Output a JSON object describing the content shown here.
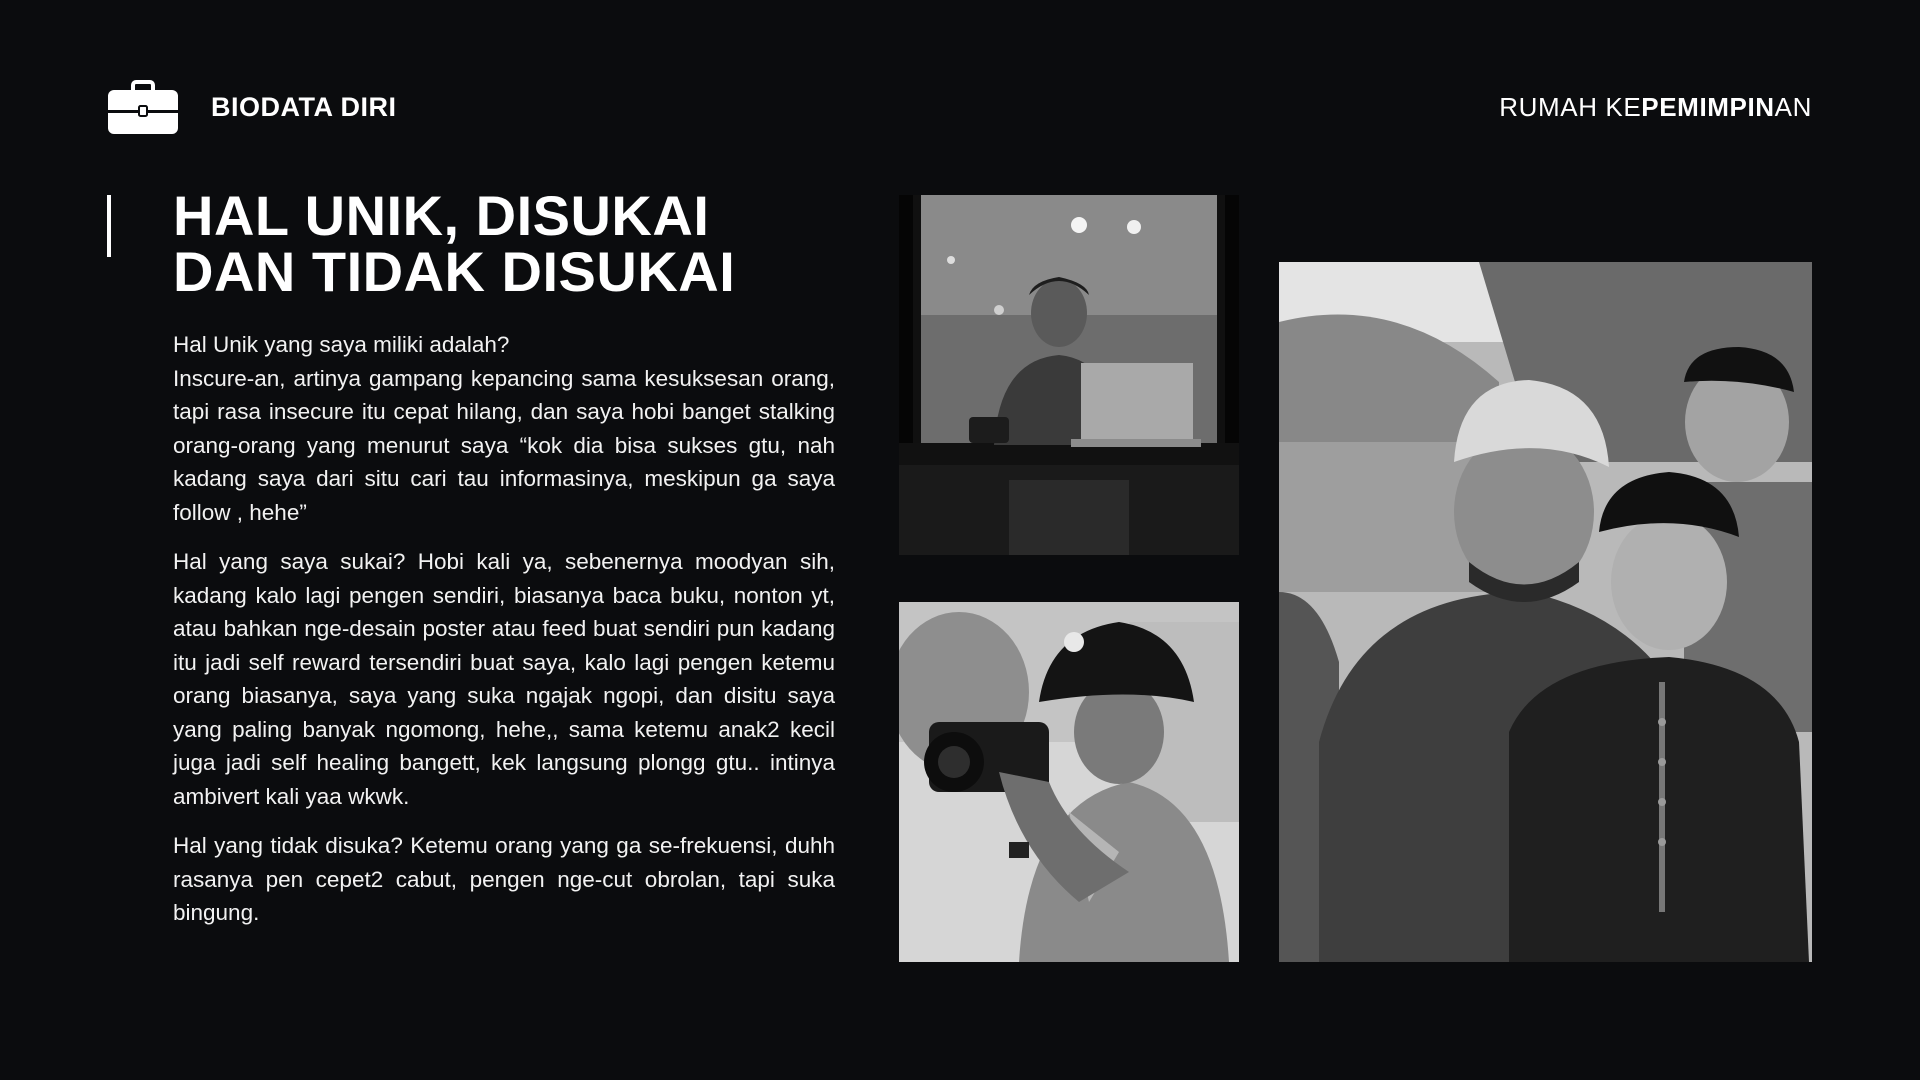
{
  "header": {
    "logo_icon": "briefcase-icon",
    "section_label": "BIODATA DIRI",
    "brand": {
      "prefix": "RUMAH KE",
      "bold": "PEMIMPIN",
      "suffix": "AN"
    }
  },
  "title": {
    "line1": "HAL UNIK, DISUKAI",
    "line2": "DAN TIDAK DISUKAI"
  },
  "paragraphs": {
    "unique_question": "Hal Unik yang saya miliki adalah?",
    "unique_answer": "Inscure-an, artinya gampang kepancing sama kesuksesan orang, tapi rasa insecure itu cepat hilang, dan saya hobi banget stalking orang-orang yang menurut saya “kok dia bisa sukses gtu, nah kadang saya dari situ cari tau informasinya, meskipun ga saya follow , hehe”",
    "likes": "Hal yang saya sukai? Hobi kali ya, sebenernya moodyan sih, kadang kalo lagi pengen sendiri, biasanya baca buku, nonton yt, atau bahkan nge-desain poster atau feed buat sendiri pun kadang itu jadi self reward tersendiri buat saya, kalo lagi pengen ketemu orang biasanya, saya yang suka ngajak ngopi, dan disitu saya yang paling banyak ngomong, hehe,, sama ketemu anak2 kecil juga jadi self healing bangett, kek langsung plongg gtu.. intinya ambivert kali yaa wkwk.",
    "dislikes": "Hal yang tidak disuka? Ketemu orang yang ga se-frekuensi, duhh rasanya pen cepet2 cabut, pengen nge-cut obrolan, tapi suka bingung."
  },
  "colors": {
    "background": "#0b0c0e",
    "text": "#ffffff"
  }
}
